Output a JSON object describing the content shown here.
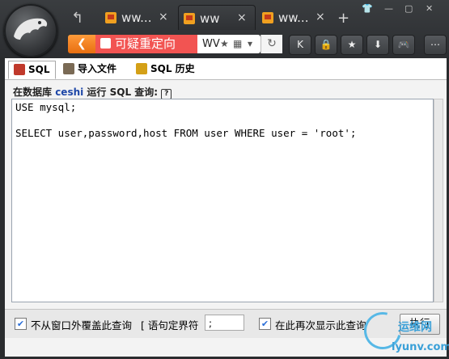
{
  "browser": {
    "tabs": [
      {
        "title": "ww...",
        "active": false
      },
      {
        "title": "ww",
        "active": true
      },
      {
        "title": "ww...",
        "active": false
      }
    ],
    "new_tab": "+",
    "close_glyph": "×",
    "redirect_warning": "可疑重定向",
    "url_fragment": "WV",
    "toolbar_icons": [
      "k-icon",
      "lock-icon",
      "star-icon",
      "download-icon",
      "gamepad-icon",
      "menu-icon"
    ]
  },
  "phpmyadmin": {
    "tabs": [
      {
        "label": "SQL",
        "icon": "sql-icon",
        "active": true
      },
      {
        "label": "导入文件",
        "icon": "import-icon",
        "active": false
      },
      {
        "label": "SQL 历史",
        "icon": "history-icon",
        "active": false
      }
    ],
    "legend_prefix": "在数据库 ",
    "database": "ceshi",
    "legend_suffix": " 运行 SQL 查询:",
    "help": "?",
    "query": "USE mysql;\n\nSELECT user,password,host FROM user WHERE user = 'root';",
    "no_overwrite_label": "不从窗口外覆盖此查询",
    "delimiter_label": "[ 语句定界符",
    "delimiter_value": ";",
    "show_again_label": "在此再次显示此查询",
    "execute_button": "执行"
  },
  "watermark": {
    "cn": "运维网",
    "url": "iyunv.com"
  },
  "colors": {
    "accent_orange": "#f07c1e",
    "redirect_red": "#f25452",
    "db_link": "#1f48a8"
  }
}
